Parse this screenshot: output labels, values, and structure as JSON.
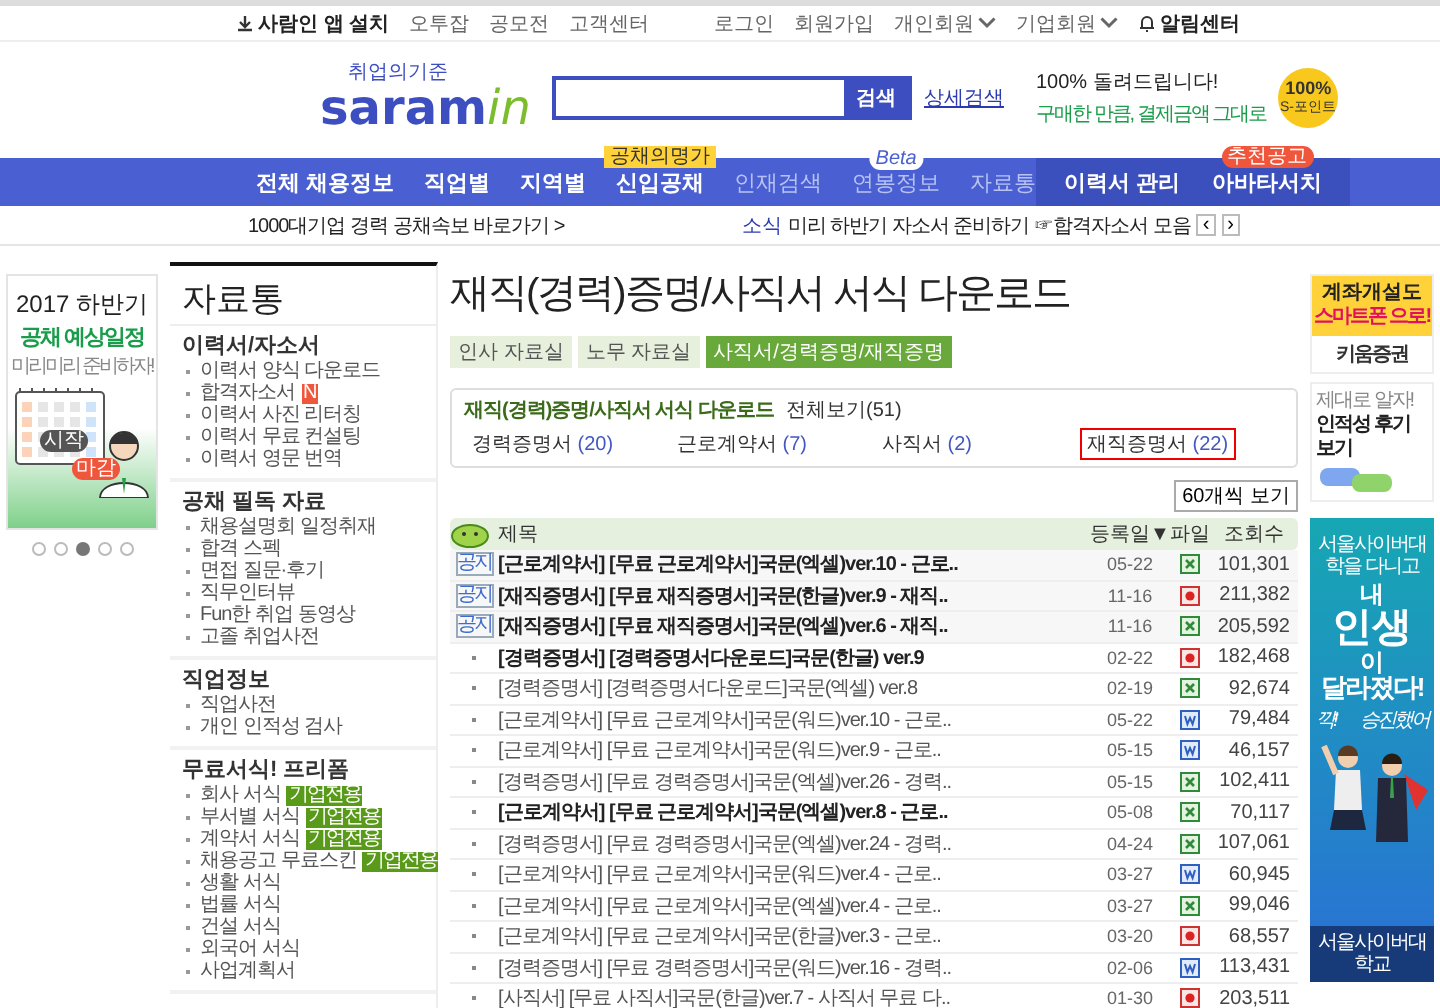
{
  "top_bar": {
    "left": [
      {
        "label": "사람인 앱 설치",
        "kind": "download"
      },
      {
        "label": "오투잡",
        "kind": "plain"
      },
      {
        "label": "공모전",
        "kind": "plain"
      },
      {
        "label": "고객센터",
        "kind": "plain"
      }
    ],
    "right": [
      {
        "label": "로그인",
        "kind": "plain",
        "dropdown": false
      },
      {
        "label": "회원가입",
        "kind": "plain",
        "dropdown": false
      },
      {
        "label": "개인회원",
        "kind": "plain",
        "dropdown": true
      },
      {
        "label": "기업회원",
        "kind": "plain",
        "dropdown": true
      },
      {
        "label": "알림센터",
        "kind": "bell",
        "dropdown": false
      }
    ]
  },
  "logo": {
    "tagline": "취업의기준",
    "name": "saram",
    "suffix": "in"
  },
  "search": {
    "button": "검색",
    "advanced": "상세검색"
  },
  "promo": {
    "headline": "100% 돌려드립니다!",
    "subline": "구매한 만큼, 결제금액 그대로",
    "coin_value": "100%",
    "coin_label": "S-포인트"
  },
  "nav": {
    "items": [
      {
        "label": "전체 채용정보",
        "emphasis": true
      },
      {
        "label": "직업별",
        "emphasis": true
      },
      {
        "label": "지역별",
        "emphasis": true
      },
      {
        "label": "신입공채",
        "emphasis": true,
        "badge": {
          "text": "공채의명가",
          "kind": "ribbon"
        }
      },
      {
        "label": "인재검색",
        "emphasis": false
      },
      {
        "label": "연봉정보",
        "emphasis": false,
        "badge": {
          "text": "Beta",
          "kind": "pill"
        }
      },
      {
        "label": "자료통",
        "emphasis": false
      }
    ],
    "right": [
      {
        "label": "이력서 관리"
      },
      {
        "label": "아바타서치",
        "badge": {
          "text": "추천공고",
          "kind": "hot"
        }
      }
    ]
  },
  "sub_bar": {
    "link": "1000대기업 경력 공채속보 바로가기 >",
    "news_label": "소식",
    "news_text": "미리 하반기 자소서 준비하기 ☞합격자소서 모음",
    "prev": "‹",
    "next": "›"
  },
  "left_banner": {
    "year_title": "2017 하반기",
    "title": "공채 예상일정",
    "subtitle": "미리미리 준비하자!",
    "start_tag": "시작",
    "end_tag": "마감",
    "dots": [
      {
        "selected": false
      },
      {
        "selected": false
      },
      {
        "selected": true
      },
      {
        "selected": false
      },
      {
        "selected": false
      }
    ]
  },
  "sidebar": {
    "title": "자료통",
    "groups": [
      {
        "title": "이력서/자소서",
        "items": [
          {
            "label": "이력서 양식 다운로드"
          },
          {
            "label": "합격자소서",
            "badge": {
              "text": "N",
              "kind": "new"
            }
          },
          {
            "label": "이력서 사진 리터칭"
          },
          {
            "label": "이력서 무료 컨설팅"
          },
          {
            "label": "이력서 영문 번역"
          }
        ]
      },
      {
        "title": "공채 필독 자료",
        "items": [
          {
            "label": "채용설명회 일정취재"
          },
          {
            "label": "합격 스펙"
          },
          {
            "label": "면접 질문·후기"
          },
          {
            "label": "직무인터뷰"
          },
          {
            "label": "Fun한 취업 동영상"
          },
          {
            "label": "고졸 취업사전"
          }
        ]
      },
      {
        "title": "직업정보",
        "items": [
          {
            "label": "직업사전"
          },
          {
            "label": "개인 인적성 검사"
          }
        ]
      },
      {
        "title": "무료서식! 프리폼",
        "items": [
          {
            "label": "회사 서식",
            "badge": {
              "text": "기업전용",
              "kind": "corp"
            }
          },
          {
            "label": "부서별 서식",
            "badge": {
              "text": "기업전용",
              "kind": "corp"
            }
          },
          {
            "label": "계약서 서식",
            "badge": {
              "text": "기업전용",
              "kind": "corp"
            }
          },
          {
            "label": "채용공고 무료스킨",
            "badge": {
              "text": "기업전용",
              "kind": "corp"
            }
          },
          {
            "label": "생활 서식"
          },
          {
            "label": "법률 서식"
          },
          {
            "label": "건설 서식"
          },
          {
            "label": "외국어 서식"
          },
          {
            "label": "사업계획서"
          }
        ]
      }
    ]
  },
  "page_title": "재직(경력)증명/사직서 서식 다운로드",
  "tabs": [
    {
      "label": "인사 자료실",
      "selected": false
    },
    {
      "label": "노무 자료실",
      "selected": false
    },
    {
      "label": "사직서/경력증명/재직증명",
      "selected": true
    }
  ],
  "filter": {
    "title": "재직(경력)증명/사직서 서식 다운로드",
    "all": "전체보기(51)",
    "categories": [
      {
        "label": "경력증명서",
        "count": "(20)",
        "selected": false
      },
      {
        "label": "근로계약서",
        "count": "(7)",
        "selected": false
      },
      {
        "label": "사직서",
        "count": "(2)",
        "selected": false
      },
      {
        "label": "재직증명서",
        "count": "(22)",
        "selected": true
      }
    ]
  },
  "page_size": "60개씩 보기",
  "table": {
    "columns": [
      "제목",
      "등록일▼",
      "파일",
      "조회수"
    ],
    "rows": [
      {
        "kind": "notice",
        "notice_label": "공지",
        "title": "[근로계약서] [무료 근로계약서]국문(엑셀)ver.10 - 근로..",
        "bold": true,
        "date": "05-22",
        "file": {
          "kind": "excel"
        },
        "views": "101,301"
      },
      {
        "kind": "notice",
        "notice_label": "공지",
        "title": "[재직증명서] [무료 재직증명서]국문(한글)ver.9 - 재직..",
        "bold": true,
        "date": "11-16",
        "file": {
          "kind": "hwp"
        },
        "views": "211,382"
      },
      {
        "kind": "notice",
        "notice_label": "공지",
        "title": "[재직증명서] [무료 재직증명서]국문(엑셀)ver.6 - 재직..",
        "bold": true,
        "date": "11-16",
        "file": {
          "kind": "excel"
        },
        "views": "205,592"
      },
      {
        "kind": "normal",
        "title": "[경력증명서] [경력증명서다운로드]국문(한글) ver.9",
        "bold": true,
        "date": "02-22",
        "file": {
          "kind": "hwp"
        },
        "views": "182,468"
      },
      {
        "kind": "normal",
        "title": "[경력증명서] [경력증명서다운로드]국문(엑셀) ver.8",
        "bold": false,
        "date": "02-19",
        "file": {
          "kind": "excel"
        },
        "views": "92,674"
      },
      {
        "kind": "normal",
        "title": "[근로계약서] [무료 근로계약서]국문(워드)ver.10 - 근로..",
        "bold": false,
        "date": "05-22",
        "file": {
          "kind": "word"
        },
        "views": "79,484"
      },
      {
        "kind": "normal",
        "title": "[근로계약서] [무료 근로계약서]국문(워드)ver.9 - 근로..",
        "bold": false,
        "date": "05-15",
        "file": {
          "kind": "word"
        },
        "views": "46,157"
      },
      {
        "kind": "normal",
        "title": "[경력증명서] [무료 경력증명서]국문(엑셀)ver.26 - 경력..",
        "bold": false,
        "date": "05-15",
        "file": {
          "kind": "excel"
        },
        "views": "102,411"
      },
      {
        "kind": "normal",
        "title": "[근로계약서] [무료 근로계약서]국문(엑셀)ver.8 - 근로..",
        "bold": true,
        "date": "05-08",
        "file": {
          "kind": "excel"
        },
        "views": "70,117"
      },
      {
        "kind": "normal",
        "title": "[경력증명서] [무료 경력증명서]국문(엑셀)ver.24 - 경력..",
        "bold": false,
        "date": "04-24",
        "file": {
          "kind": "excel"
        },
        "views": "107,061"
      },
      {
        "kind": "normal",
        "title": "[근로계약서] [무료 근로계약서]국문(워드)ver.4 - 근로..",
        "bold": false,
        "date": "03-27",
        "file": {
          "kind": "word"
        },
        "views": "60,945"
      },
      {
        "kind": "normal",
        "title": "[근로계약서] [무료 근로계약서]국문(엑셀)ver.4 - 근로..",
        "bold": false,
        "date": "03-27",
        "file": {
          "kind": "excel"
        },
        "views": "99,046"
      },
      {
        "kind": "normal",
        "title": "[근로계약서] [무료 근로계약서]국문(한글)ver.3 - 근로..",
        "bold": false,
        "date": "03-20",
        "file": {
          "kind": "hwp"
        },
        "views": "68,557"
      },
      {
        "kind": "normal",
        "title": "[경력증명서] [무료 경력증명서]국문(워드)ver.16 - 경력..",
        "bold": false,
        "date": "02-06",
        "file": {
          "kind": "word"
        },
        "views": "113,431"
      },
      {
        "kind": "normal",
        "title": "[사직서] [무료 사직서]국문(한글)ver.7 - 사직서 무료 다..",
        "bold": false,
        "date": "01-30",
        "file": {
          "kind": "hwp"
        },
        "views": "203,511"
      }
    ]
  },
  "right_ads": {
    "securities": {
      "line1": "계좌개설도",
      "line2": "스마트폰 으로!",
      "brand": "키움증권"
    },
    "review": {
      "line1": "제대로 알자!",
      "line2": "인적성 후기 보기"
    },
    "university": {
      "intro": "서울사이버대학을 다니고",
      "big": [
        "내",
        "인생",
        "이",
        "달라졌다!"
      ],
      "bubbles": [
        "꺅!",
        "승진했어"
      ],
      "footer": "서울사이버대학교"
    }
  }
}
